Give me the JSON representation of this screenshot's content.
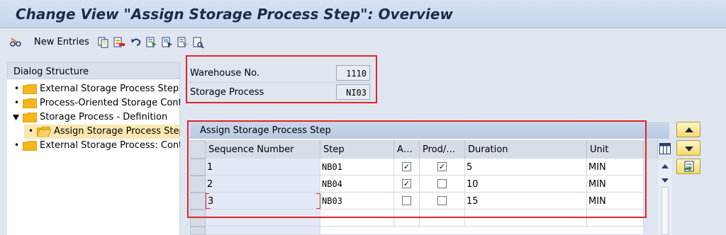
{
  "window": {
    "title": "Change View \"Assign Storage Process Step\": Overview"
  },
  "toolbar": {
    "new_entries_label": "New Entries",
    "icons": [
      "glasses-edit-icon",
      "copy-icon",
      "delete-icon",
      "undo-icon",
      "select-all-icon",
      "select-block-icon",
      "deselect-all-icon",
      "where-used-icon"
    ]
  },
  "dialog_structure": {
    "title": "Dialog Structure",
    "items": [
      {
        "label": "External Storage Process Step",
        "level": 1,
        "expanded": false,
        "selected": false
      },
      {
        "label": "Process-Oriented Storage Cont",
        "level": 1,
        "expanded": false,
        "selected": false
      },
      {
        "label": "Storage Process - Definition",
        "level": 1,
        "expanded": true,
        "selected": false
      },
      {
        "label": "Assign Storage Process Step",
        "level": 2,
        "expanded": false,
        "selected": true
      },
      {
        "label": "External Storage Process: Cont",
        "level": 1,
        "expanded": false,
        "selected": false
      }
    ]
  },
  "header_fields": {
    "warehouse": {
      "label": "Warehouse No.",
      "value": "1110"
    },
    "storage_process": {
      "label": "Storage Process",
      "value": "NI03"
    }
  },
  "table": {
    "title": "Assign Storage Process Step",
    "columns": [
      "Sequence Number",
      "Step",
      "A…",
      "Prod/…",
      "Duration",
      "Unit"
    ],
    "rows": [
      {
        "seq": "1",
        "step": "NB01",
        "a": true,
        "prod": true,
        "duration": "5",
        "unit": "MIN"
      },
      {
        "seq": "2",
        "step": "NB04",
        "a": true,
        "prod": false,
        "duration": "10",
        "unit": "MIN"
      },
      {
        "seq": "3",
        "step": "NB03",
        "a": false,
        "prod": false,
        "duration": "15",
        "unit": "MIN"
      }
    ]
  },
  "colors": {
    "highlight_box": "#e0242b",
    "selected_tree_item": "#fbe7b0",
    "title_text": "#1c2c48"
  }
}
